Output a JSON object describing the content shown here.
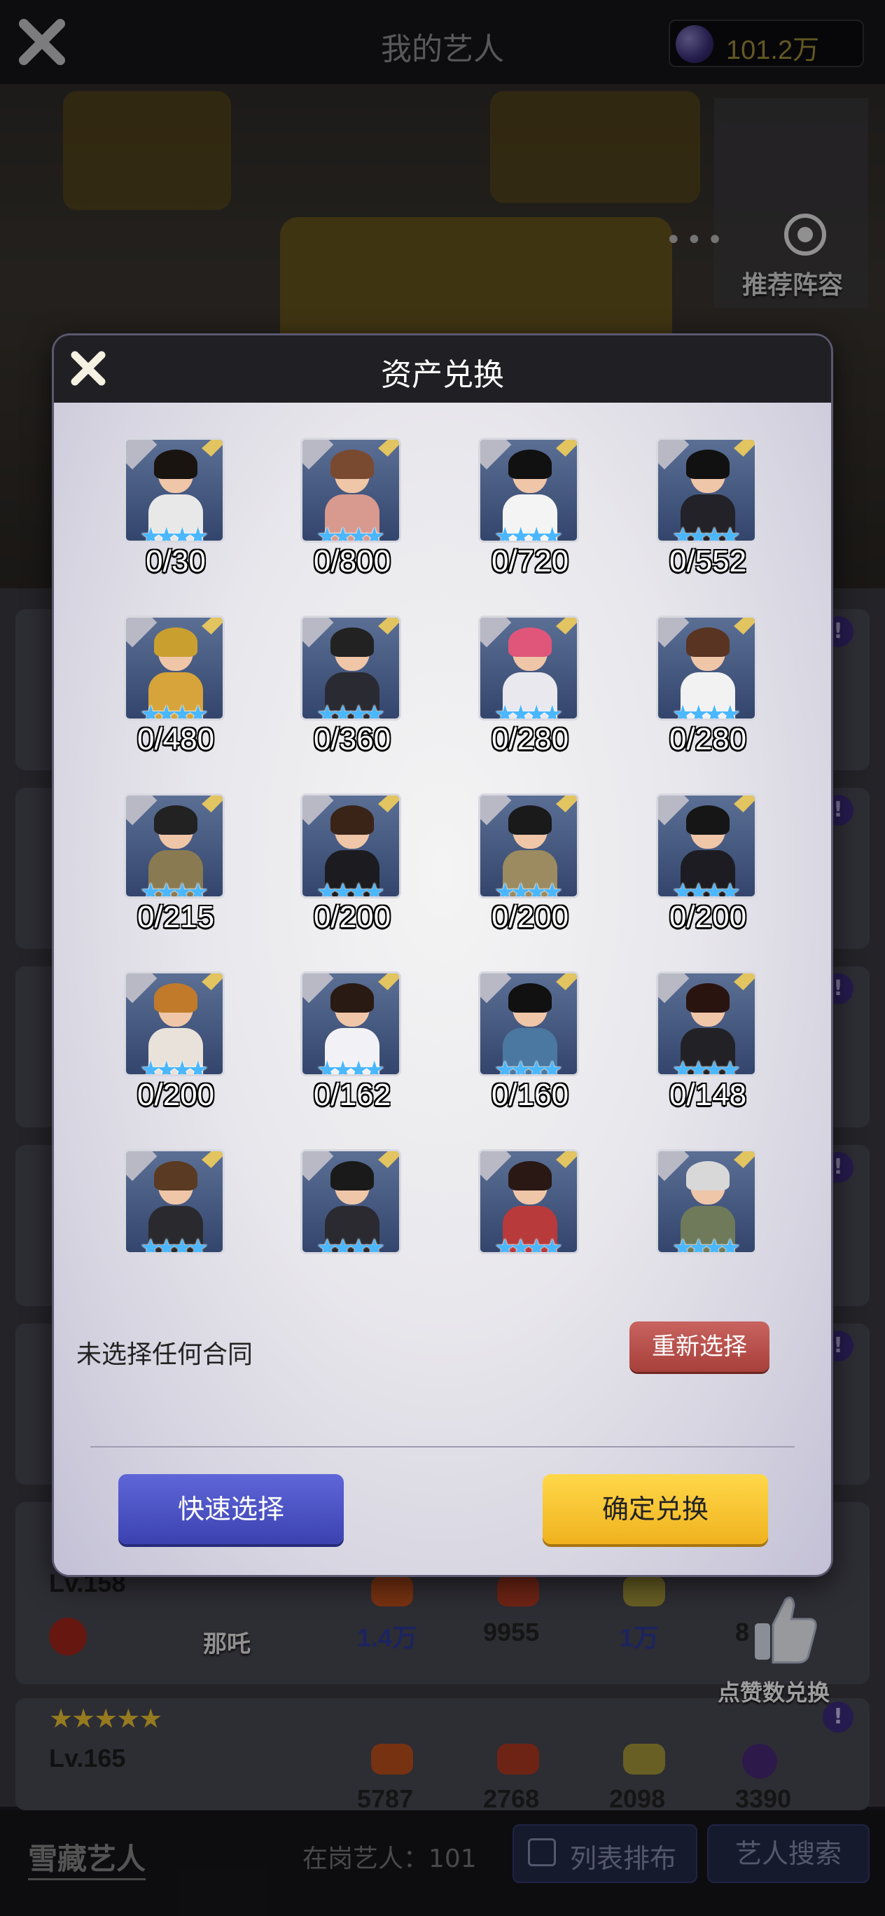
{
  "topbar": {
    "title": "我的艺人",
    "currency": "101.2万"
  },
  "scene": {
    "more": "•••",
    "recommend_label": "推荐阵容"
  },
  "list": {
    "cards": [
      {
        "level": "Lv.158",
        "stats": [
          "1.4万",
          "9955",
          "1万",
          "8"
        ]
      },
      {
        "level": "Lv.165",
        "stars": "★★★★★",
        "stats": [
          "5787",
          "2768",
          "2098",
          "3390"
        ]
      }
    ],
    "char_name": "那吒",
    "thumb_label": "点赞数兑换"
  },
  "bottombar": {
    "hidden_tab": "雪藏艺人",
    "on_duty": "在岗艺人：101",
    "sort_label": "列表排布",
    "search_label": "艺人搜索"
  },
  "modal": {
    "title": "资产兑换",
    "status": "未选择任何合同",
    "reselect": "重新选择",
    "quick_select": "快速选择",
    "confirm": "确定兑换",
    "contracts": [
      {
        "count": "0/30",
        "hair": "#1a1410",
        "outfit": "#e8e8e8"
      },
      {
        "count": "0/800",
        "hair": "#7a4a30",
        "outfit": "#d89a8e"
      },
      {
        "count": "0/720",
        "hair": "#111111",
        "outfit": "#f4f4f4"
      },
      {
        "count": "0/552",
        "hair": "#111111",
        "outfit": "#222228"
      },
      {
        "count": "0/480",
        "hair": "#c9a030",
        "outfit": "#d6a43a"
      },
      {
        "count": "0/360",
        "hair": "#222222",
        "outfit": "#2a2a32"
      },
      {
        "count": "0/280",
        "hair": "#e0567a",
        "outfit": "#e8e8ee"
      },
      {
        "count": "0/280",
        "hair": "#5a3422",
        "outfit": "#f2f2f2"
      },
      {
        "count": "0/215",
        "hair": "#222222",
        "outfit": "#8a7a52"
      },
      {
        "count": "0/200",
        "hair": "#3a2418",
        "outfit": "#1c1c20"
      },
      {
        "count": "0/200",
        "hair": "#1a1a1a",
        "outfit": "#9c8a60"
      },
      {
        "count": "0/200",
        "hair": "#161616",
        "outfit": "#1c1c22"
      },
      {
        "count": "0/200",
        "hair": "#c07a2a",
        "outfit": "#e9e2da"
      },
      {
        "count": "0/162",
        "hair": "#2a1a14",
        "outfit": "#f2f2f6"
      },
      {
        "count": "0/160",
        "hair": "#111111",
        "outfit": "#4a78a0"
      },
      {
        "count": "0/148",
        "hair": "#2a1410",
        "outfit": "#222226"
      },
      {
        "count": "",
        "hair": "#5a3a22",
        "outfit": "#2a2a2e"
      },
      {
        "count": "",
        "hair": "#1a1a1a",
        "outfit": "#2a2a30"
      },
      {
        "count": "",
        "hair": "#2a1814",
        "outfit": "#b83a3a"
      },
      {
        "count": "",
        "hair": "#d8d8d8",
        "outfit": "#6e7a5a"
      }
    ]
  },
  "colors": {
    "accent_blue_star": "#4ab7ff",
    "confirm": "#f5c22c",
    "quick": "#4a50c4",
    "reselect": "#b24c47"
  }
}
